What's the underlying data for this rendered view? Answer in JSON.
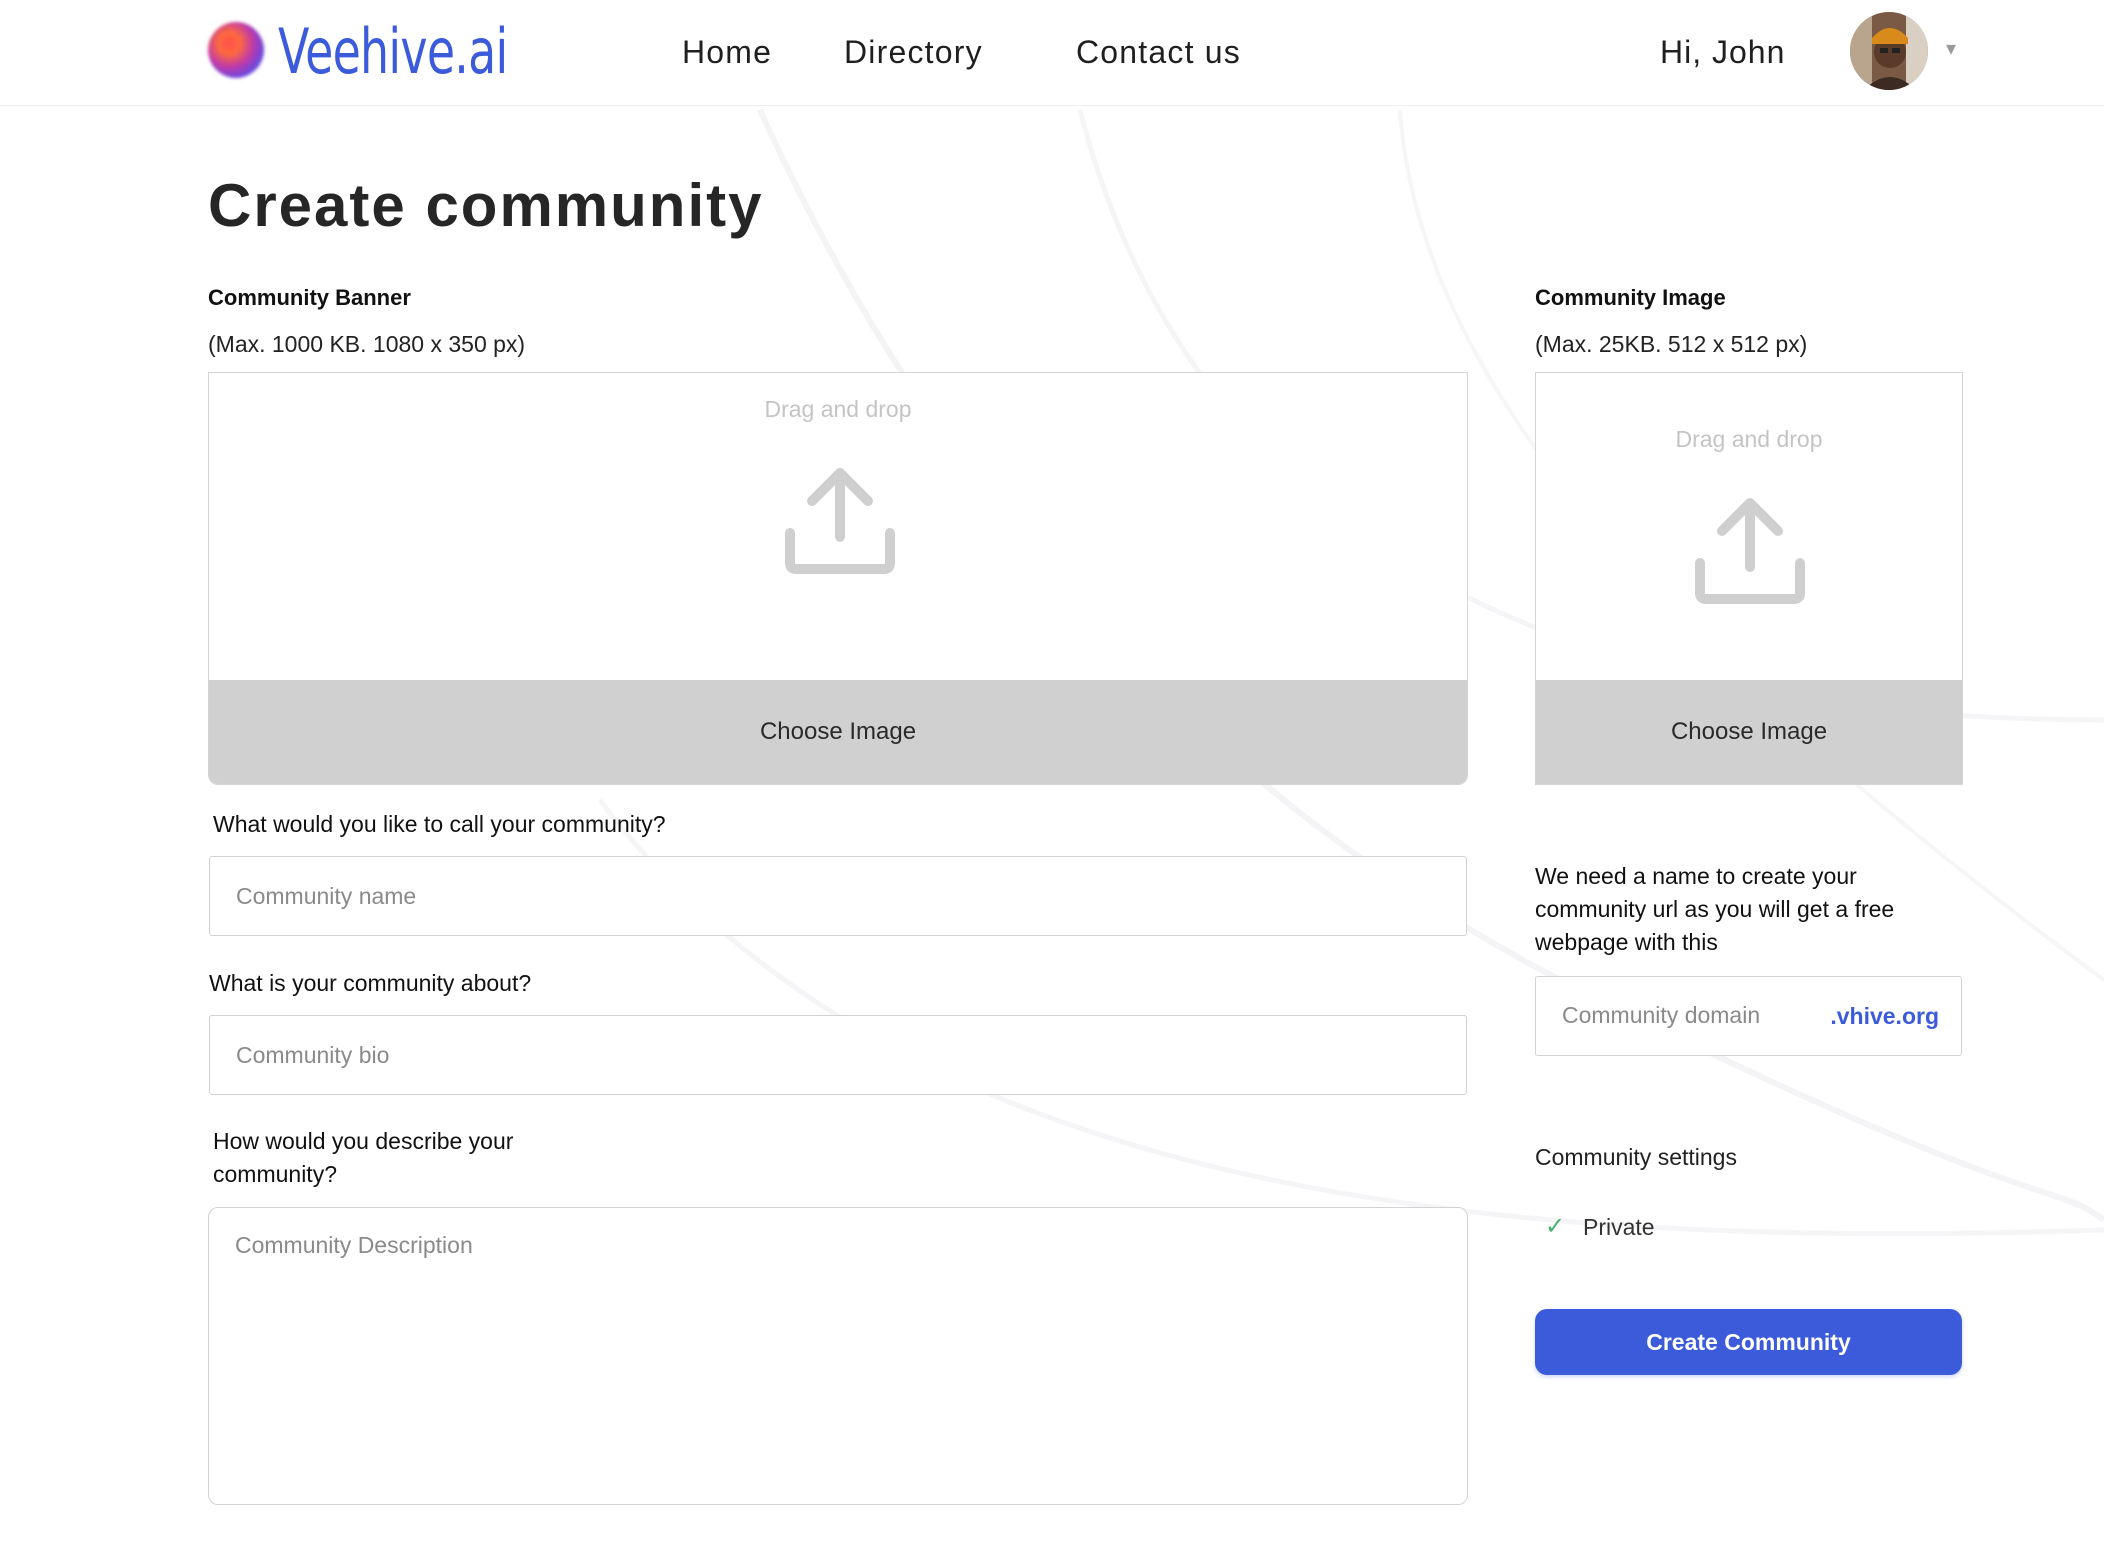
{
  "header": {
    "logo_text": "Veehive.ai",
    "nav": [
      {
        "label": "Home"
      },
      {
        "label": "Directory"
      },
      {
        "label": "Contact us"
      }
    ],
    "greeting": "Hi, John",
    "caret": "▾"
  },
  "page": {
    "title": "Create community"
  },
  "banner": {
    "label": "Community Banner",
    "hint": "(Max. 1000 KB. 1080 x 350 px)",
    "drop_text": "Drag and drop",
    "button_label": "Choose Image"
  },
  "image": {
    "label": "Community Image",
    "hint": "(Max. 25KB. 512 x 512 px)",
    "drop_text": "Drag and drop",
    "button_label": "Choose Image"
  },
  "form": {
    "name_question": "What would you like to call your community?",
    "name_placeholder": "Community name",
    "bio_question": "What is your community about?",
    "bio_placeholder": "Community bio",
    "description_question_line1": "How would you describe your",
    "description_question_line2": "community?",
    "description_placeholder": "Community Description"
  },
  "domain": {
    "note": "We need a name to create your community url as you will get a free webpage with this",
    "placeholder": "Community domain",
    "suffix": ".vhive.org"
  },
  "settings": {
    "label": "Community settings",
    "private_label": "Private",
    "private_checked": true
  },
  "submit": {
    "label": "Create Community"
  },
  "colors": {
    "accent": "#3b5bdb",
    "check": "#4caf6a",
    "dropzone_button": "#d0d0d0"
  }
}
